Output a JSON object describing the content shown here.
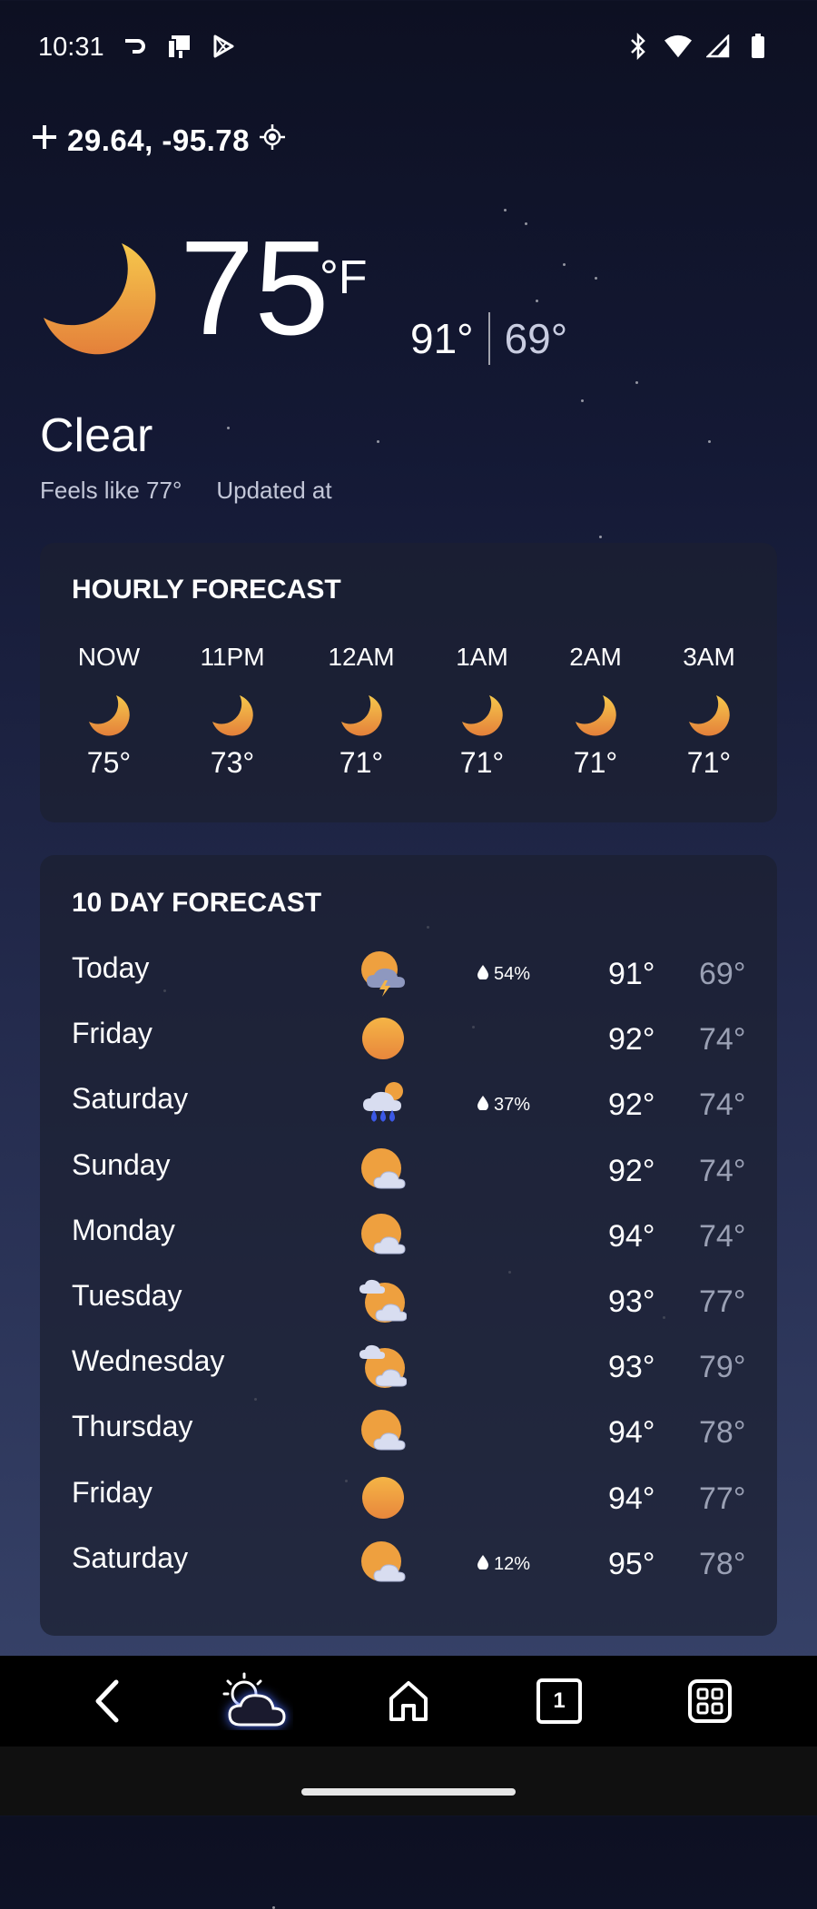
{
  "status_bar": {
    "time": "10:31",
    "left_icons": [
      "cast-icon",
      "device-icon",
      "play-store-icon"
    ],
    "right_icons": [
      "bluetooth-icon",
      "wifi-icon",
      "signal-icon",
      "battery-icon"
    ]
  },
  "location": {
    "coords": "29.64, -95.78",
    "add_icon": "plus-icon",
    "locate_icon": "location-target-icon"
  },
  "current": {
    "icon": "moon-icon",
    "temp": "75",
    "unit": "°F",
    "high": "91°",
    "low": "69°",
    "condition": "Clear",
    "feels_like": "Feels like 77°",
    "updated": "Updated at"
  },
  "hourly": {
    "title": "HOURLY FORECAST",
    "items": [
      {
        "time": "NOW",
        "temp": "75°",
        "icon": "moon-icon"
      },
      {
        "time": "11PM",
        "temp": "73°",
        "icon": "moon-icon"
      },
      {
        "time": "12AM",
        "temp": "71°",
        "icon": "moon-icon"
      },
      {
        "time": "1AM",
        "temp": "71°",
        "icon": "moon-icon"
      },
      {
        "time": "2AM",
        "temp": "71°",
        "icon": "moon-icon"
      },
      {
        "time": "3AM",
        "temp": "71°",
        "icon": "moon-icon"
      }
    ]
  },
  "daily": {
    "title": "10 DAY FORECAST",
    "items": [
      {
        "day": "Today",
        "icon": "thunderstorm-icon",
        "rain": "54%",
        "high": "91°",
        "low": "69°"
      },
      {
        "day": "Friday",
        "icon": "sun-icon",
        "rain": "",
        "high": "92°",
        "low": "74°"
      },
      {
        "day": "Saturday",
        "icon": "rain-icon",
        "rain": "37%",
        "high": "92°",
        "low": "74°"
      },
      {
        "day": "Sunday",
        "icon": "partly-cloudy-icon",
        "rain": "",
        "high": "92°",
        "low": "74°"
      },
      {
        "day": "Monday",
        "icon": "partly-cloudy-icon",
        "rain": "",
        "high": "94°",
        "low": "74°"
      },
      {
        "day": "Tuesday",
        "icon": "mostly-cloudy-icon",
        "rain": "",
        "high": "93°",
        "low": "77°"
      },
      {
        "day": "Wednesday",
        "icon": "mostly-cloudy-icon",
        "rain": "",
        "high": "93°",
        "low": "79°"
      },
      {
        "day": "Thursday",
        "icon": "partly-cloudy-icon",
        "rain": "",
        "high": "94°",
        "low": "78°"
      },
      {
        "day": "Friday",
        "icon": "sun-icon",
        "rain": "",
        "high": "94°",
        "low": "77°"
      },
      {
        "day": "Saturday",
        "icon": "partly-cloudy-icon",
        "rain": "12%",
        "high": "95°",
        "low": "78°"
      }
    ]
  },
  "nav": {
    "buttons": [
      "back-icon",
      "weather-app-icon",
      "home-icon",
      "tabs-icon",
      "apps-grid-icon"
    ],
    "tab_count": "1"
  },
  "colors": {
    "sun_orange": "#f0a53a",
    "moon_gradient_top": "#f6c04a",
    "moon_gradient_bottom": "#e6843a",
    "accent_blue": "#4a6cff"
  }
}
